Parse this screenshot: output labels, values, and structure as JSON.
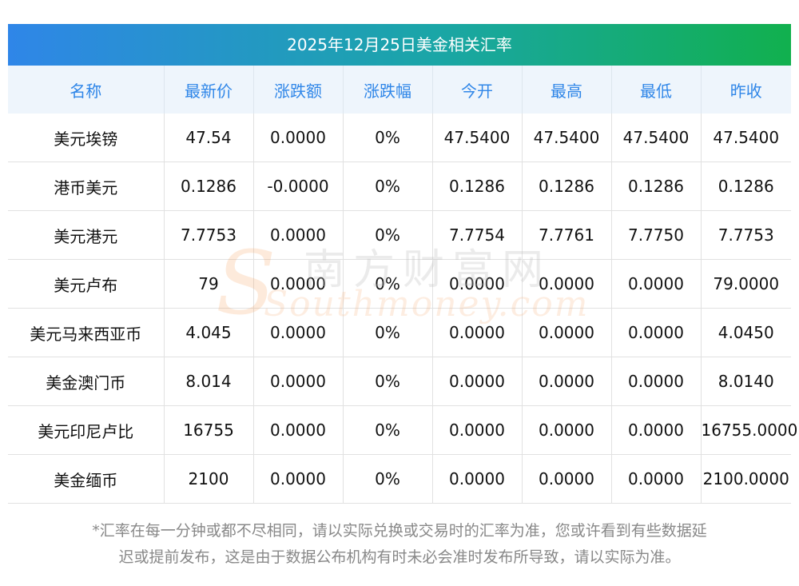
{
  "title": "2025年12月25日美金相关汇率",
  "headers": [
    "名称",
    "最新价",
    "涨跌额",
    "涨跌幅",
    "今开",
    "最高",
    "最低",
    "昨收"
  ],
  "rows": [
    [
      "美元埃镑",
      "47.54",
      "0.0000",
      "0%",
      "47.5400",
      "47.5400",
      "47.5400",
      "47.5400"
    ],
    [
      "港币美元",
      "0.1286",
      "-0.0000",
      "0%",
      "0.1286",
      "0.1286",
      "0.1286",
      "0.1286"
    ],
    [
      "美元港元",
      "7.7753",
      "0.0000",
      "0%",
      "7.7754",
      "7.7761",
      "7.7750",
      "7.7753"
    ],
    [
      "美元卢布",
      "79",
      "0.0000",
      "0%",
      "0.0000",
      "0.0000",
      "0.0000",
      "79.0000"
    ],
    [
      "美元马来西亚币",
      "4.045",
      "0.0000",
      "0%",
      "0.0000",
      "0.0000",
      "0.0000",
      "4.0450"
    ],
    [
      "美金澳门币",
      "8.014",
      "0.0000",
      "0%",
      "0.0000",
      "0.0000",
      "0.0000",
      "8.0140"
    ],
    [
      "美元印尼卢比",
      "16755",
      "0.0000",
      "0%",
      "0.0000",
      "0.0000",
      "0.0000",
      "16755.0000"
    ],
    [
      "美金缅币",
      "2100",
      "0.0000",
      "0%",
      "0.0000",
      "0.0000",
      "0.0000",
      "2100.0000"
    ]
  ],
  "note_line1": "*汇率在每一分钟或都不尽相同，请以实际兑换或交易时的汇率为准，您或许看到有些数据延",
  "note_line2": "迟或提前发布，这是由于数据公布机构有时未必会准时发布所导致，请以实际为准。",
  "watermark": {
    "cn": "南方财富网",
    "en": "Southmoney.com"
  }
}
